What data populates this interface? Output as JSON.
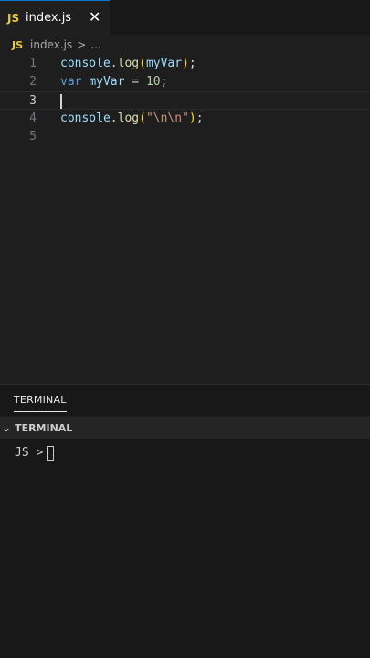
{
  "tab": {
    "icon_label": "JS",
    "filename": "index.js",
    "close": "✕"
  },
  "breadcrumb": {
    "icon_label": "JS",
    "file": "index.js",
    "separator": ">",
    "more": "..."
  },
  "editor": {
    "lines": [
      {
        "number": "1",
        "tokens": [
          {
            "text": "console",
            "kind": "var"
          },
          {
            "text": ".",
            "kind": "plain"
          },
          {
            "text": "log",
            "kind": "fn"
          },
          {
            "text": "(",
            "kind": "br"
          },
          {
            "text": "myVar",
            "kind": "var"
          },
          {
            "text": ")",
            "kind": "br"
          },
          {
            "text": ";",
            "kind": "plain"
          }
        ]
      },
      {
        "number": "2",
        "tokens": [
          {
            "text": "var",
            "kind": "kw"
          },
          {
            "text": " ",
            "kind": "plain"
          },
          {
            "text": "myVar",
            "kind": "var"
          },
          {
            "text": " = ",
            "kind": "plain"
          },
          {
            "text": "10",
            "kind": "num"
          },
          {
            "text": ";",
            "kind": "plain"
          }
        ]
      },
      {
        "number": "3",
        "tokens": []
      },
      {
        "number": "4",
        "tokens": [
          {
            "text": "console",
            "kind": "var"
          },
          {
            "text": ".",
            "kind": "plain"
          },
          {
            "text": "log",
            "kind": "fn"
          },
          {
            "text": "(",
            "kind": "br"
          },
          {
            "text": "\"\\n\\n\"",
            "kind": "str"
          },
          {
            "text": ")",
            "kind": "br"
          },
          {
            "text": ";",
            "kind": "plain"
          }
        ]
      },
      {
        "number": "5",
        "tokens": []
      }
    ]
  },
  "panel": {
    "tab_label": "TERMINAL",
    "section_label": "TERMINAL",
    "chevron": "⌄"
  },
  "terminal": {
    "prompt": "JS >"
  },
  "colors": {
    "accent": "#0078d4",
    "js_icon": "#e8c743",
    "background": "#1e1e1e"
  }
}
